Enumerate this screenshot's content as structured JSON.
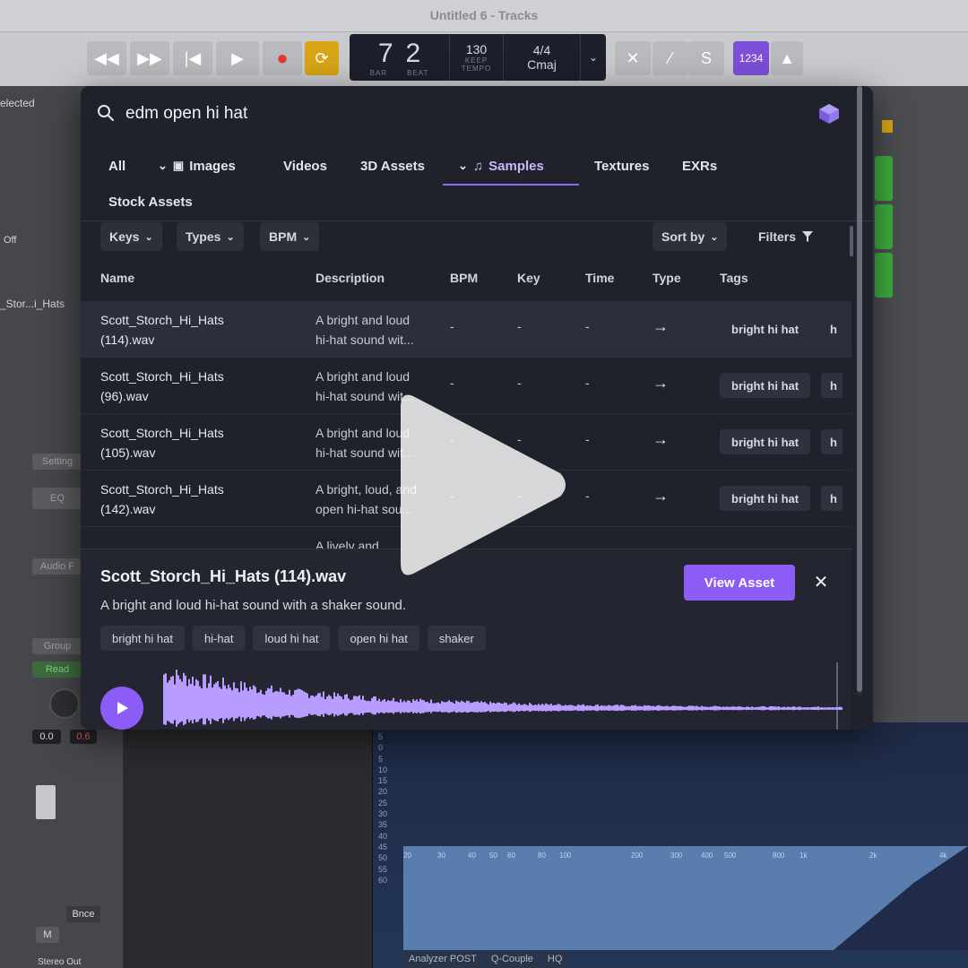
{
  "daw": {
    "title": "Untitled 6 - Tracks",
    "lcd": {
      "bar": "7",
      "beat": "2",
      "bar_label": "BAR",
      "beat_label": "BEAT",
      "tempo": "130",
      "keep": "KEEP",
      "tempo_label": "TEMPO",
      "signature": "4/4",
      "key": "Cmaj"
    },
    "purple_button": "1234",
    "left_panel": {
      "selected": "elected",
      "off": "Off",
      "track": "_Stor...i_Hats",
      "setting": "Setting",
      "eq": "EQ",
      "audio": "Audio F",
      "group": "Group",
      "read": "Read",
      "vol_a": "0.0",
      "vol_b": "0.6",
      "bnce": "Bnce",
      "m": "M",
      "stereo": "Stereo Out"
    },
    "eq": {
      "db_scale": [
        "5",
        "0",
        "5",
        "10",
        "15",
        "20",
        "25",
        "30",
        "35",
        "40",
        "45",
        "50",
        "55",
        "60"
      ],
      "freqs": [
        "20",
        "30",
        "40",
        "50",
        "60",
        "80",
        "100",
        "200",
        "300",
        "400",
        "500",
        "800",
        "1k",
        "2k",
        "4k"
      ],
      "tabs": [
        "Analyzer POST",
        "Q-Couple",
        "HQ"
      ]
    }
  },
  "search": {
    "query": "edm open hi hat",
    "placeholder": "Search"
  },
  "tabs": [
    {
      "label": "All"
    },
    {
      "label": "Images"
    },
    {
      "label": "Videos"
    },
    {
      "label": "3D Assets"
    },
    {
      "label": "Samples",
      "active": true
    },
    {
      "label": "Textures"
    },
    {
      "label": "EXRs"
    },
    {
      "label": "Stock Assets"
    }
  ],
  "filters": {
    "keys": "Keys",
    "types": "Types",
    "bpm": "BPM",
    "sort": "Sort by",
    "filters": "Filters"
  },
  "table": {
    "columns": [
      "Name",
      "Description",
      "BPM",
      "Key",
      "Time",
      "Type",
      "Tags"
    ],
    "rows": [
      {
        "name_a": "Scott_Storch_Hi_Hats",
        "name_b": "(114).wav",
        "desc_a": "A bright and loud",
        "desc_b": "hi-hat sound wit...",
        "bpm": "-",
        "key": "-",
        "time": "-",
        "type": "→",
        "tag": "bright hi hat",
        "tag_more": "h"
      },
      {
        "name_a": "Scott_Storch_Hi_Hats",
        "name_b": "(96).wav",
        "desc_a": "A bright and loud",
        "desc_b": "hi-hat sound wit...",
        "bpm": "-",
        "key": "-",
        "time": "-",
        "type": "→",
        "tag": "bright hi hat",
        "tag_more": "h"
      },
      {
        "name_a": "Scott_Storch_Hi_Hats",
        "name_b": "(105).wav",
        "desc_a": "A bright and loud",
        "desc_b": "hi-hat sound wit...",
        "bpm": "-",
        "key": "-",
        "time": "-",
        "type": "→",
        "tag": "bright hi hat",
        "tag_more": "h"
      },
      {
        "name_a": "Scott_Storch_Hi_Hats",
        "name_b": "(142).wav",
        "desc_a": "A bright, loud, and",
        "desc_b": "open hi-hat sou...",
        "bpm": "-",
        "key": "-",
        "time": "-",
        "type": "→",
        "tag": "bright hi hat",
        "tag_more": "h"
      },
      {
        "name_a": "",
        "name_b": "",
        "desc_a": "A lively and",
        "desc_b": "",
        "bpm": "",
        "key": "",
        "time": "",
        "type": "",
        "tag": "",
        "tag_more": ""
      }
    ]
  },
  "detail": {
    "title": "Scott_Storch_Hi_Hats (114).wav",
    "description": "A bright and loud hi-hat sound with a shaker sound.",
    "tags": [
      "bright hi hat",
      "hi-hat",
      "loud hi hat",
      "open hi hat",
      "shaker"
    ],
    "view_button": "View Asset",
    "accent": "#8b5cf6"
  }
}
